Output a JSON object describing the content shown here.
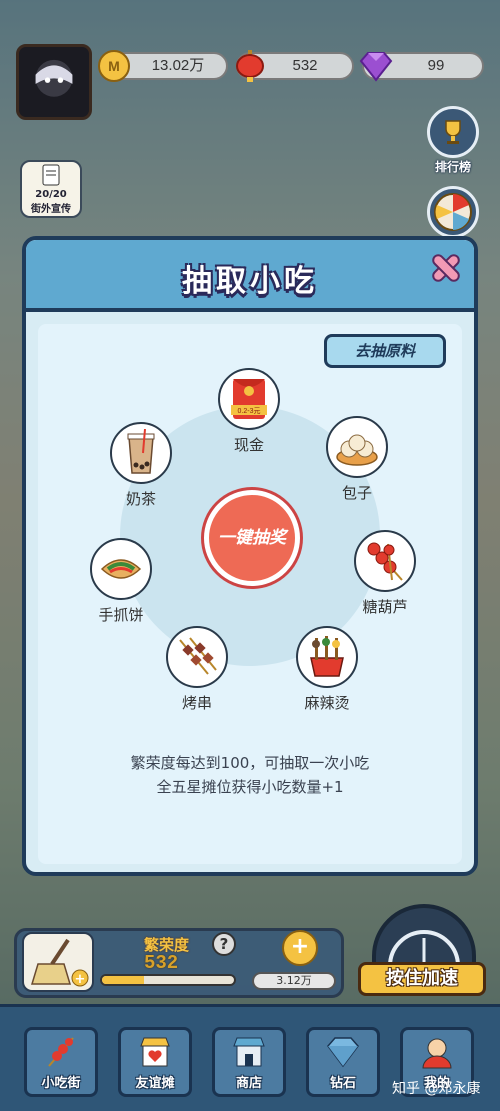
{
  "resources": {
    "coins": "13.02万",
    "lanterns": "532",
    "gems": "99"
  },
  "side_buttons": {
    "leaderboard": "排行榜",
    "promo_count": "20/20",
    "promo_label": "街外宣传"
  },
  "modal": {
    "title": "抽取小吃",
    "ingredients_button": "去抽原料",
    "draw_button": "一键抽奖",
    "prizes": [
      {
        "label": "现金",
        "icon": "red-envelope-icon",
        "badge": "0.2-3元"
      },
      {
        "label": "包子",
        "icon": "bun-icon"
      },
      {
        "label": "糖葫芦",
        "icon": "candied-haws-icon"
      },
      {
        "label": "麻辣烫",
        "icon": "malatang-icon"
      },
      {
        "label": "烤串",
        "icon": "skewer-icon"
      },
      {
        "label": "手抓饼",
        "icon": "pancake-icon"
      },
      {
        "label": "奶茶",
        "icon": "milk-tea-icon"
      }
    ],
    "desc_line1": "繁荣度每达到100，可抽取一次小吃",
    "desc_line2": "全五星摊位获得小吃数量+1"
  },
  "bottom": {
    "prosperity_label": "繁荣度",
    "prosperity_value": "532",
    "prosperity_progress": 0.32,
    "coin_rate": "3.12万",
    "speed_button": "按住加速",
    "help": "?"
  },
  "navbar": [
    {
      "label": "小吃街",
      "icon": "snack-street-icon"
    },
    {
      "label": "友谊摊",
      "icon": "friendship-stall-icon"
    },
    {
      "label": "商店",
      "icon": "shop-icon"
    },
    {
      "label": "钻石",
      "icon": "diamond-icon"
    },
    {
      "label": "我的",
      "icon": "profile-icon"
    }
  ],
  "watermark": "知乎 @邓永康",
  "colors": {
    "modal_header": "#5fa9d0",
    "draw_button": "#ee6a55",
    "border_dark": "#1f3b5a",
    "gold": "#f4c242"
  }
}
